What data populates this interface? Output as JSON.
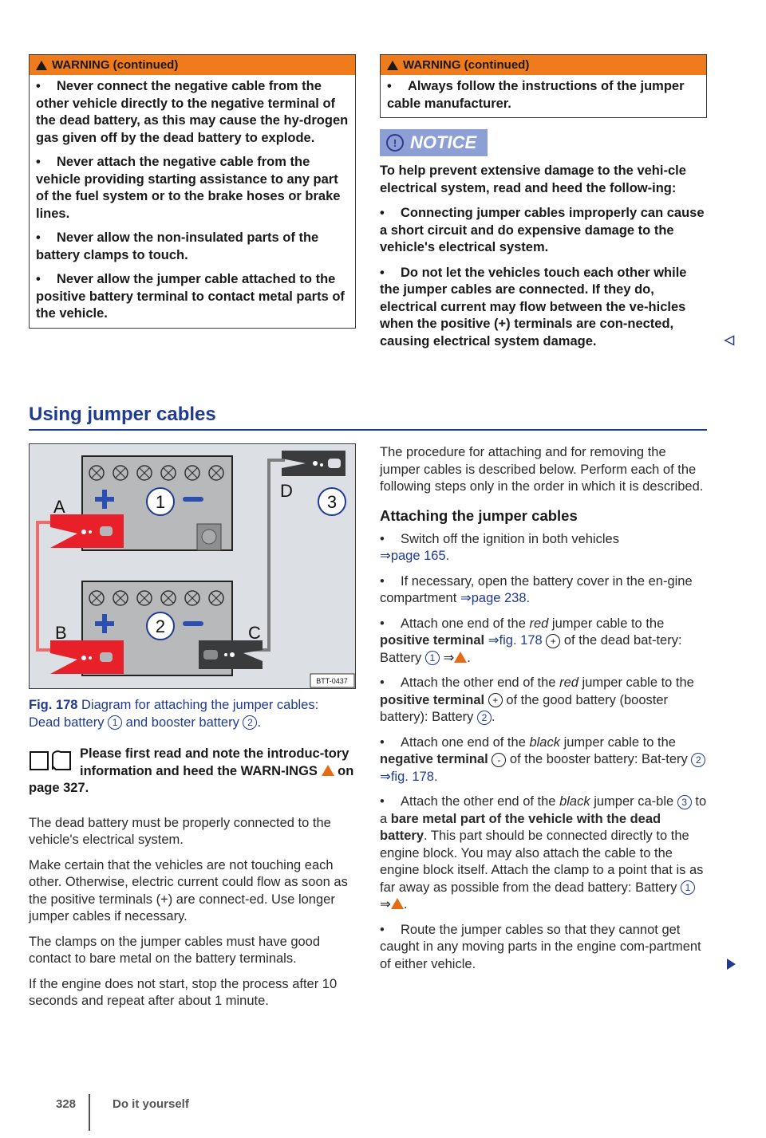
{
  "left_warning": {
    "title": "WARNING (continued)",
    "items": [
      "Never connect the negative cable from the other vehicle directly to the negative terminal of the dead battery, as this may cause the hy-drogen gas given off by the dead battery to explode.",
      "Never attach the negative cable from the vehicle providing starting assistance to any part of the fuel system or to the brake hoses or brake lines.",
      "Never allow the non-insulated parts of the battery clamps to touch.",
      "Never allow the jumper cable attached to the positive battery terminal to contact metal parts of the vehicle."
    ]
  },
  "right_warning": {
    "title": "WARNING (continued)",
    "items": [
      "Always follow the instructions of the jumper cable manufacturer."
    ]
  },
  "notice": {
    "label": "NOTICE",
    "icon": "exclamation-circle-icon",
    "intro": "To help prevent extensive damage to the vehi-cle electrical system, read and heed the follow-ing:",
    "items": [
      "Connecting jumper cables improperly can cause a short circuit and do expensive damage to the vehicle's electrical system.",
      "Do not let the vehicles touch each other while the jumper cables are connected. If they do, electrical current may flow between the ve-hicles when the positive (+) terminals are con-nected, causing electrical system damage."
    ],
    "end_marker": "◁"
  },
  "section": {
    "title": "Using jumper cables"
  },
  "figure": {
    "labels": {
      "a": "A",
      "b": "B",
      "c": "C",
      "d": "D"
    },
    "callouts": {
      "one": "1",
      "two": "2",
      "three": "3"
    },
    "code": "BTT-0437",
    "caption_fig": "Fig. 178",
    "caption_text_1": "Diagram for attaching the jumper cables:",
    "caption_text_2": "Dead battery",
    "caption_and": "and booster battery",
    "caption_end": "."
  },
  "read_first": {
    "text_1": "Please first read and note the introduc-tory information and heed the WARN-INGS",
    "text_2": "on page 327."
  },
  "left_paragraphs": [
    "The dead battery must be properly connected to the vehicle's electrical system.",
    "Make certain that the vehicles are not touching each other. Otherwise, electric current could flow as soon as the positive terminals (+) are connect-ed. Use longer jumper cables if necessary.",
    "The clamps on the jumper cables must have good contact to bare metal on the battery terminals.",
    "If the engine does not start, stop the process after 10 seconds and repeat after about 1 minute."
  ],
  "right_intro": "The procedure for attaching and for removing the jumper cables is described below. Perform each of the following steps only in the order in which it is described.",
  "attaching": {
    "title": "Attaching the jumper cables",
    "step1": {
      "text": "Switch off the ignition in both vehicles",
      "ref": "⇒page 165."
    },
    "step2": {
      "text": "If necessary, open the battery cover in the en-gine compartment",
      "ref": "⇒page 238."
    },
    "step3": {
      "a": "Attach one end of the",
      "em": "red",
      "b": "jumper cable to the",
      "bold": "positive terminal",
      "ref": "⇒fig. 178",
      "sym": "+",
      "c": "of the dead bat-tery: Battery",
      "num": "1",
      "arrow": "⇒"
    },
    "step4": {
      "a": "Attach the other end of the",
      "em": "red",
      "b": "jumper cable to the",
      "bold": "positive terminal",
      "sym": "+",
      "c": "of the good battery (booster battery): Battery",
      "num": "2",
      "end": "."
    },
    "step5": {
      "a": "Attach one end of the",
      "em": "black",
      "b": "jumper cable to the",
      "bold": "negative terminal",
      "sym": "-",
      "c": "of the booster battery: Bat-tery",
      "num": "2",
      "ref": "⇒fig. 178."
    },
    "step6": {
      "a": "Attach the other end of the",
      "em": "black",
      "b": "jumper ca-ble",
      "num": "3",
      "c": "to a",
      "bold": "bare metal part of the vehicle with the dead battery",
      "d": ". This part should be connected directly to the engine block. You may also attach the cable to the engine block itself. Attach the clamp to a point that is as far away as possible from the dead battery: Battery",
      "num2": "1",
      "arrow": "⇒"
    },
    "step7": {
      "text": "Route the jumper cables so that they cannot get caught in any moving parts in the engine com-partment of either vehicle."
    }
  },
  "footer": {
    "page": "328",
    "chapter": "Do it yourself"
  }
}
